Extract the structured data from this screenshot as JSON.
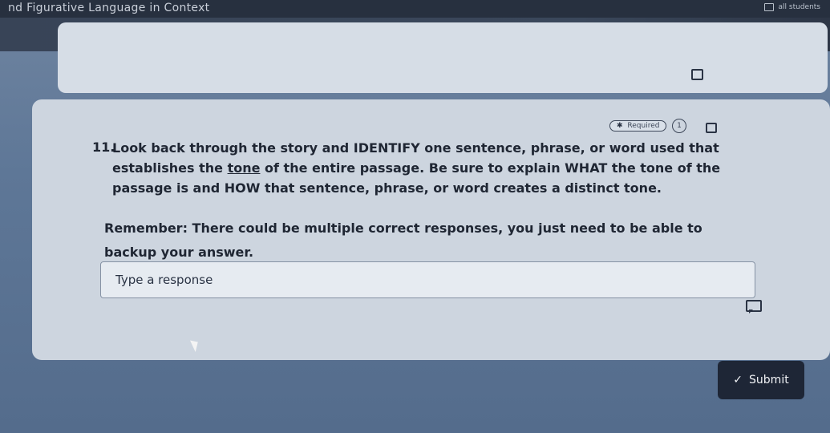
{
  "header": {
    "title": "nd Figurative Language in Context",
    "status_text": "all students"
  },
  "question": {
    "required_label": "Required",
    "points": "1",
    "number": "11.",
    "text_part1": "Look back through the story and IDENTIFY one sentence, phrase, or word used that establishes the ",
    "text_underlined": "tone",
    "text_part2": " of the entire passage. Be sure to explain WHAT the tone of the passage is and HOW that sentence, phrase, or word creates a distinct tone.",
    "note": "Remember: There could be multiple correct responses, you just need to be able to backup your answer."
  },
  "response": {
    "placeholder": "Type a response",
    "value": ""
  },
  "footer": {
    "submit_label": "Submit"
  },
  "icons": {
    "required": "asterisk-icon",
    "bookmark": "bookmark-icon",
    "comment": "comment-icon",
    "submit": "checkmark-icon"
  }
}
